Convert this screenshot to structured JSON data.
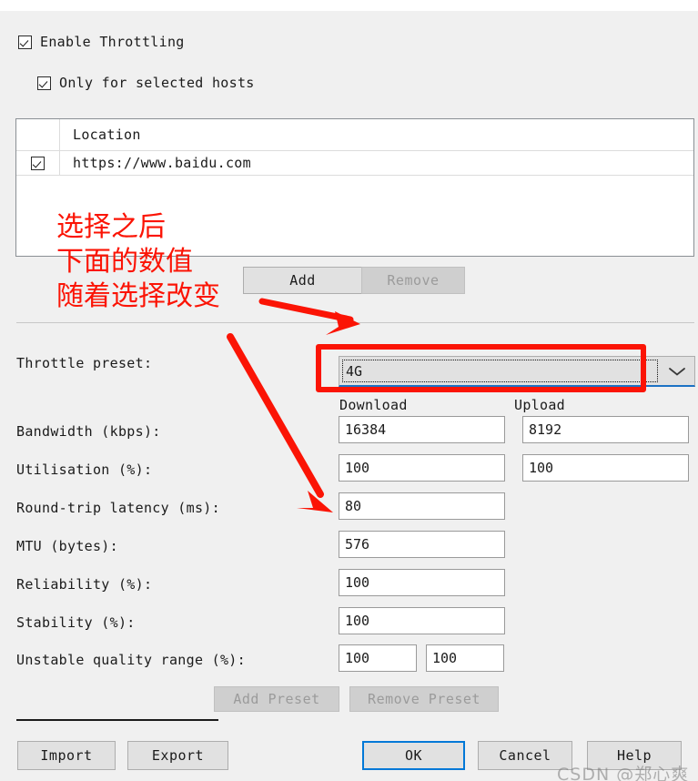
{
  "checkboxes": {
    "enable_throttling": {
      "label": "Enable Throttling",
      "checked": true
    },
    "only_selected_hosts": {
      "label": "Only for selected hosts",
      "checked": true
    }
  },
  "hosts_table": {
    "columns": [
      "",
      "Location"
    ],
    "rows": [
      {
        "checked": true,
        "location": "https://www.baidu.com"
      }
    ]
  },
  "list_buttons": {
    "add": "Add",
    "remove": "Remove"
  },
  "preset": {
    "label": "Throttle preset:",
    "value": "4G",
    "options": [
      "4G"
    ]
  },
  "column_headers": {
    "download": "Download",
    "upload": "Upload"
  },
  "fields": [
    {
      "label": "Bandwidth (kbps):",
      "download": "16384",
      "upload": "8192"
    },
    {
      "label": "Utilisation (%):",
      "download": "100",
      "upload": "100"
    },
    {
      "label": "Round-trip latency (ms):",
      "download": "80",
      "upload": null
    },
    {
      "label": "MTU (bytes):",
      "download": "576",
      "upload": null
    },
    {
      "label": "Reliability (%):",
      "download": "100",
      "upload": null
    },
    {
      "label": "Stability (%):",
      "download": "100",
      "upload": null
    },
    {
      "label": "Unstable quality range (%):",
      "download": "100",
      "upload": "100"
    }
  ],
  "preset_buttons": {
    "add_preset": "Add Preset",
    "remove_preset": "Remove Preset"
  },
  "dialog_buttons": {
    "import": "Import",
    "export": "Export",
    "ok": "OK",
    "cancel": "Cancel",
    "help": "Help"
  },
  "annotations": {
    "note": "选择之后\n下面的数值\n随着选择改变",
    "highlight_color": "#fb1405"
  },
  "watermark": "CSDN @郑心爽"
}
